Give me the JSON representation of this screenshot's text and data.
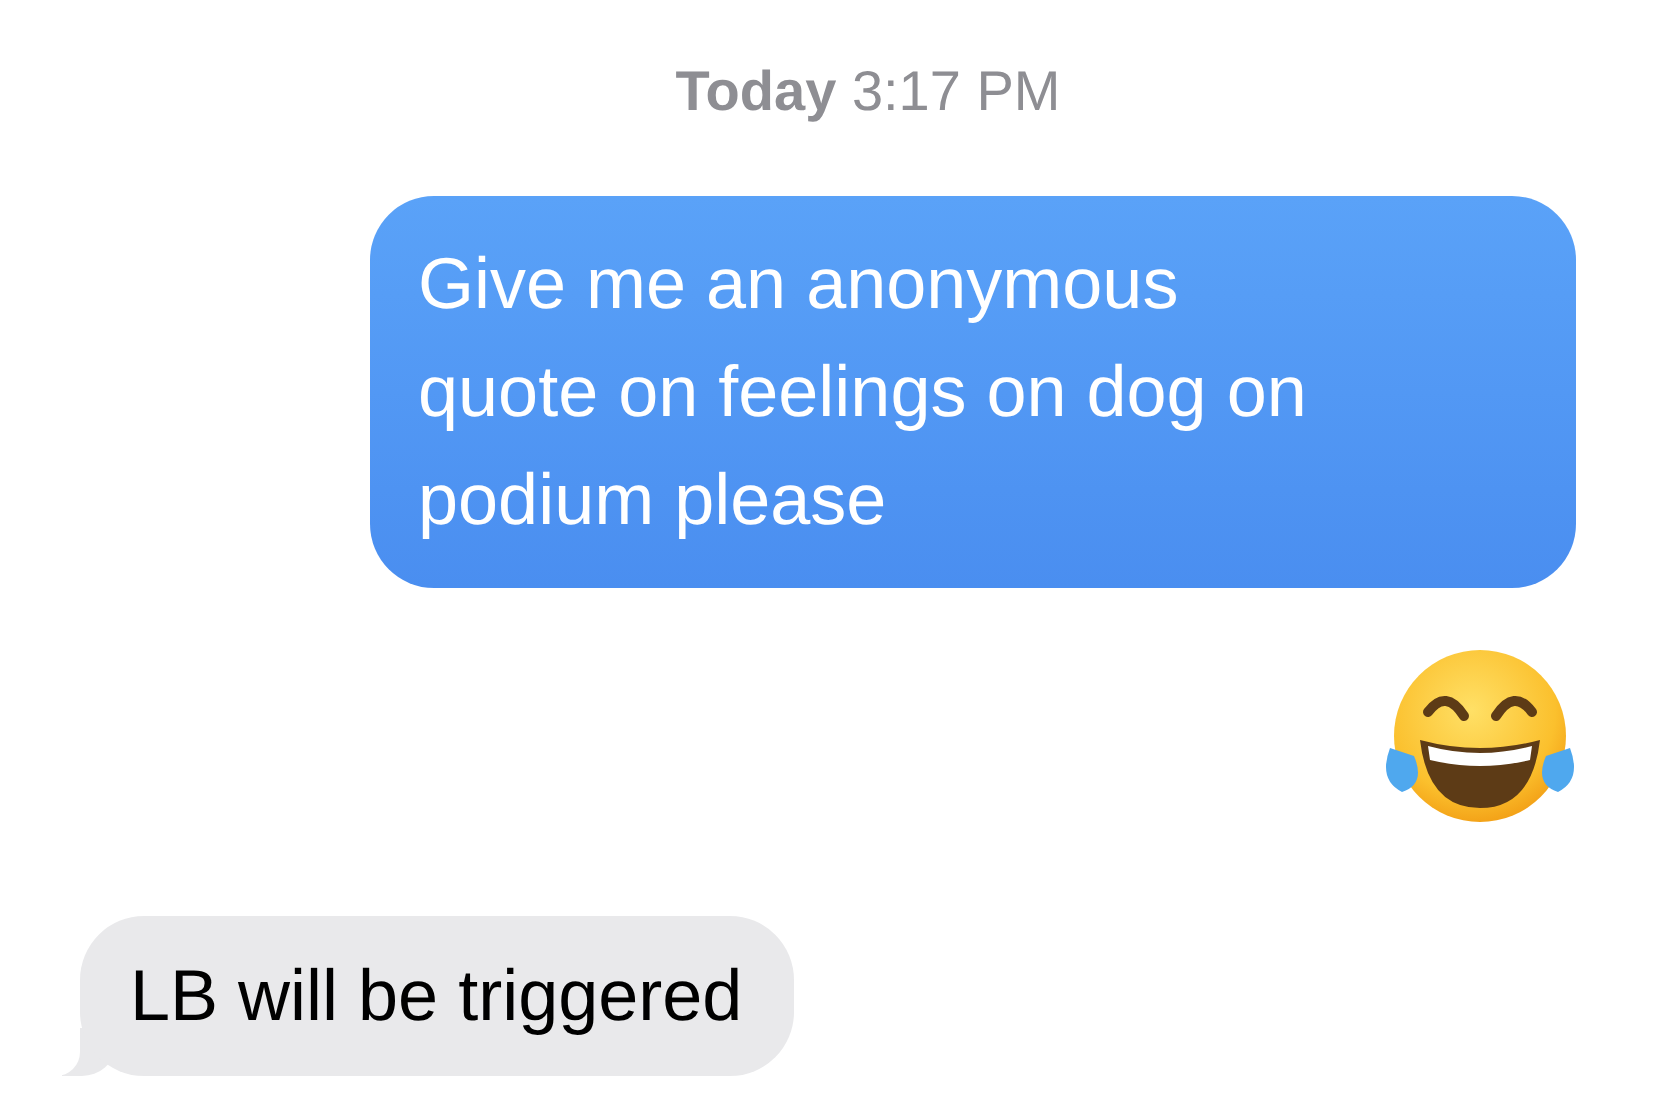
{
  "timestamp": {
    "day": "Today",
    "time": "3:17 PM"
  },
  "messages": [
    {
      "kind": "sent",
      "text": "Give me an anonymous\nquote on feelings on dog on\npodium please"
    },
    {
      "kind": "sent-emoji"
    },
    {
      "kind": "received",
      "text": "LB will be triggered"
    }
  ]
}
